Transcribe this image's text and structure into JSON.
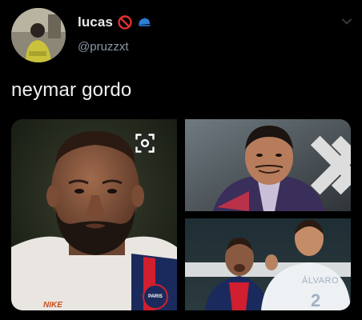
{
  "user": {
    "display_name": "lucas",
    "handle": "@pruzzxt",
    "badges": [
      "prohibited-emoji-icon",
      "blue-cap-emoji-icon"
    ]
  },
  "tweet": {
    "text": "neymar gordo"
  },
  "media": {
    "photos": [
      {
        "shirt_brand": "NIKE",
        "crest_text": "PARIS"
      },
      {},
      {
        "jersey_name": "ÁLVARO",
        "jersey_number": "2"
      }
    ]
  },
  "colors": {
    "background": "#000000",
    "text_primary": "#e7e9ea",
    "text_secondary": "#8b98a5",
    "psg_navy": "#1b2a5c",
    "psg_red": "#d11f2f"
  }
}
